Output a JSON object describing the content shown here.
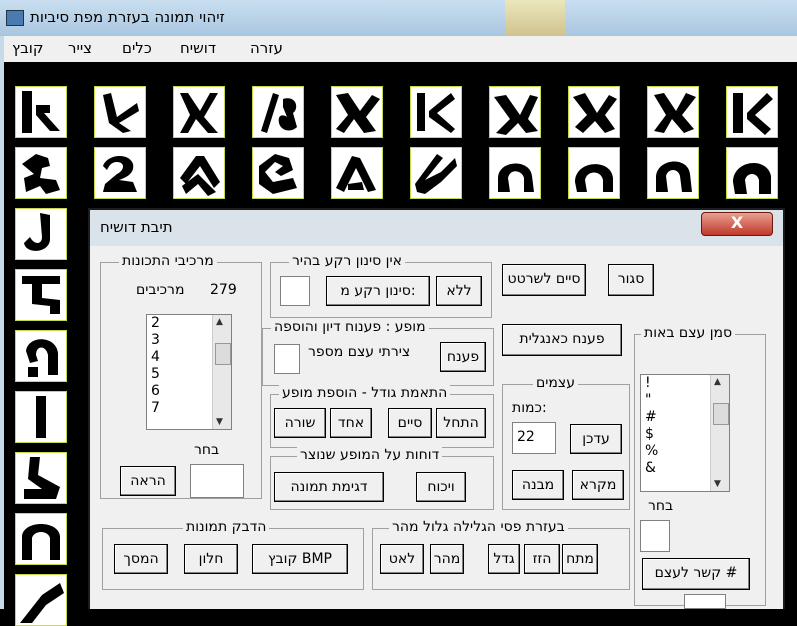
{
  "window": {
    "title": "זיהוי תמונה בעזרת מפת סיביות"
  },
  "menu": [
    "קובץ",
    "צייר",
    "כלים",
    "דושיח",
    "עזרה"
  ],
  "glyph_rows": [
    [
      "א",
      "א",
      "א",
      "א",
      "א",
      "א",
      "א",
      "א",
      "א",
      "א"
    ],
    [
      "ב",
      "ב",
      "ב",
      "ב",
      "ב",
      "ב",
      "ב",
      "ב",
      "ב",
      "ב"
    ]
  ],
  "left_column": [
    "ג",
    "ד",
    "ה",
    "ו",
    "ז",
    "ח",
    "ט"
  ],
  "dialog": {
    "title": "תיבת דושיח",
    "close_label": "X",
    "features": {
      "label": "מרכיבי התכונות",
      "count": "279",
      "count_label": "מרכיבים",
      "list": [
        "2",
        "3",
        "4",
        "5",
        "6",
        "7"
      ],
      "choose_label": "בחר",
      "show_button": "הראה"
    },
    "bg_filter": {
      "label": "אין סינון רקע בהיר",
      "none_button": "ללא",
      "filter_button": "סינון רקע מ:"
    },
    "close_button": "סגור",
    "finish_drawing_button": "סיים לשרטט",
    "appearance": {
      "label": "מופע : פענוח דיון והוספה",
      "decode_button": "פענח",
      "draw_number_label": "צירתי עצם מספר"
    },
    "size_fit": {
      "label": "התאמת גודל - הוספת מופע",
      "start_button": "התחל",
      "finish_button": "סיים",
      "one_button": "אחד",
      "row_button": "שורה"
    },
    "reports": {
      "label": "דוחות על המופע שנוצר",
      "argue_button": "ויכוח",
      "sample_button": "דגימת תמונה"
    },
    "english_button": "פענח כאנגלית",
    "objects": {
      "label": "עצמים",
      "count_label": "כמות:",
      "count_value": "22",
      "update_button": "עדכן",
      "legend_button": "מקרא",
      "structure_button": "מבנה"
    },
    "symbols": {
      "label": "סמן עצם באות",
      "list": [
        "!",
        "\"",
        "#",
        "$",
        "%",
        "&"
      ],
      "choose_label": "בחר",
      "link_button": "קשר לעצם #"
    },
    "paste": {
      "label": "הדבק תמונות",
      "file_button": "קובץ BMP",
      "window_button": "חלון",
      "screen_button": "המסך"
    },
    "scroll": {
      "label": "בעזרת פסי הגלילה גלול מהר",
      "stretch_button": "מתח",
      "move_button": "הזז",
      "enlarge_button": "גדל",
      "fast_button": "מהר",
      "slow_button": "לאט"
    }
  }
}
